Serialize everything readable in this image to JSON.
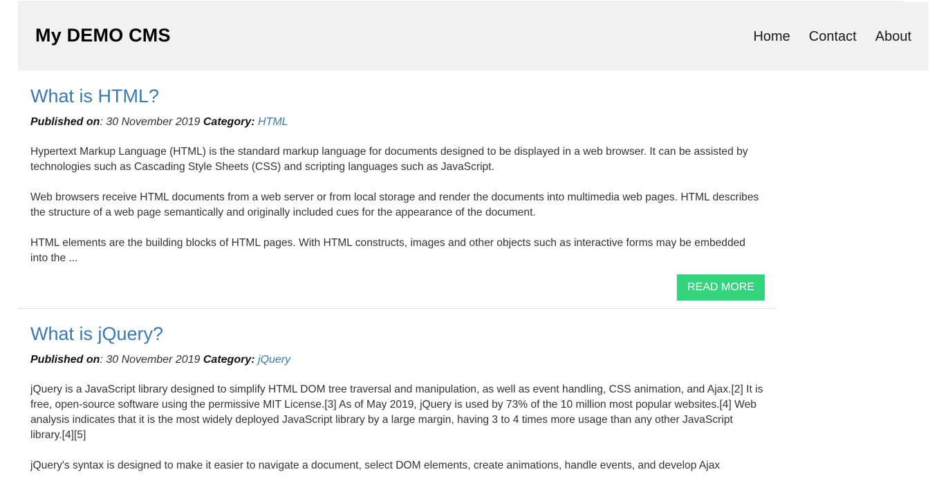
{
  "header": {
    "brand": "My DEMO CMS",
    "nav": [
      "Home",
      "Contact",
      "About"
    ]
  },
  "posts": [
    {
      "title": "What is HTML?",
      "published_label": "Published on",
      "date": ": 30 November 2019 ",
      "category_label": "Category:",
      "category": "HTML",
      "paragraphs": [
        "Hypertext Markup Language (HTML) is the standard markup language for documents designed to be displayed in a web browser. It can be assisted by technologies such as Cascading Style Sheets (CSS) and scripting languages such as JavaScript.",
        "Web browsers receive HTML documents from a web server or from local storage and render the documents into multimedia web pages. HTML describes the structure of a web page semantically and originally included cues for the appearance of the document.",
        "HTML elements are the building blocks of HTML pages. With HTML constructs, images and other objects such as interactive forms may be embedded into the ..."
      ],
      "read_more": "READ MORE"
    },
    {
      "title": "What is jQuery?",
      "published_label": "Published on",
      "date": ": 30 November 2019 ",
      "category_label": "Category:",
      "category": "jQuery",
      "paragraphs": [
        "jQuery is a JavaScript library designed to simplify HTML DOM tree traversal and manipulation, as well as event handling, CSS animation, and Ajax.[2] It is free, open-source software using the permissive MIT License.[3] As of May 2019, jQuery is used by 73% of the 10 million most popular websites.[4] Web analysis indicates that it is the most widely deployed JavaScript library by a large margin, having 3 to 4 times more usage than any other JavaScript library.[4][5]",
        "jQuery's syntax is designed to make it easier to navigate a document, select DOM elements, create animations, handle events, and develop Ajax"
      ]
    }
  ],
  "colors": {
    "header_bg": "#f1f1f1",
    "link": "#3a78b0",
    "button": "#34d37e"
  }
}
